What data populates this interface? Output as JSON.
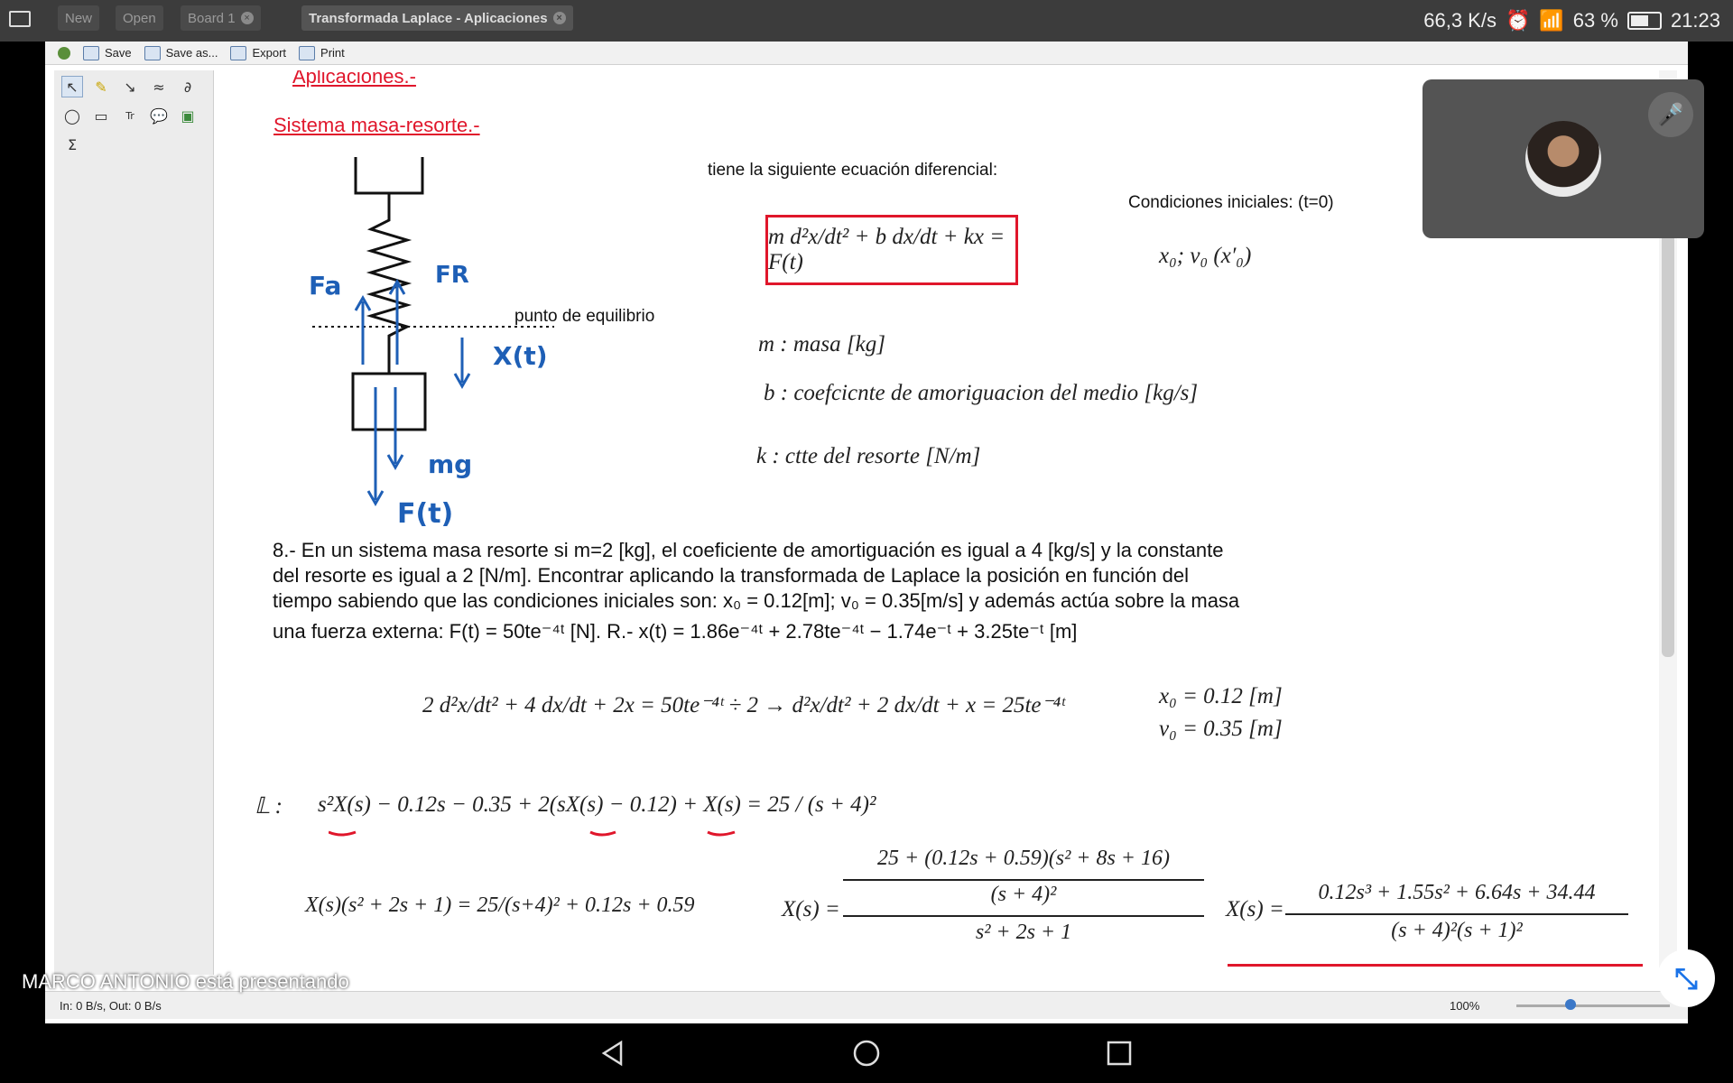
{
  "status": {
    "net_speed": "66,3 K/s",
    "battery": "63 %",
    "time": "21:23"
  },
  "tabs": [
    {
      "label": "New"
    },
    {
      "label": "Open"
    },
    {
      "label": "Board 1"
    },
    {
      "label": "Transformada Laplace - Aplicaciones"
    }
  ],
  "toolbar": {
    "save": "Save",
    "save_as": "Save as...",
    "export": "Export",
    "print": "Print"
  },
  "tools": {
    "sigma": "Σ",
    "text_tool": "Tr"
  },
  "doc": {
    "heading1": "Aplicaciones.-",
    "heading2": "Sistema masa-resorte.-",
    "diff_intro": "tiene la siguiente ecuación diferencial:",
    "init_cond": "Condiciones iniciales: (t=0)",
    "eq_main": "m d²x/dt² + b dx/dt + kx = F(t)",
    "init_vals": "x₀;  v₀ (x′₀)",
    "def_m": "m :  masa [kg]",
    "def_b": "b :  coefcicnte de amoriguacion del medio [kg/s]",
    "def_k": "k :  ctte del resorte [N/m]",
    "eq_label": "punto de equilibrio",
    "hand_fa": "Fa",
    "hand_fr": "FR",
    "hand_x": "X(t)",
    "hand_mg": "mg",
    "hand_f": "F(t)",
    "problem_l1": "8.- En un sistema masa resorte si m=2 [kg], el coeficiente de amortiguación es igual a 4 [kg/s] y la constante",
    "problem_l2": "del resorte es igual a 2 [N/m]. Encontrar aplicando la transformada de Laplace la posición en función del",
    "problem_l3": "tiempo sabiendo que las condiciones iniciales son:  x₀ = 0.12[m]; v₀ = 0.35[m/s]  y además actúa sobre la masa",
    "problem_l4": "una fuerza externa:  F(t) = 50te⁻⁴ᵗ [N]. R.-  x(t) = 1.86e⁻⁴ᵗ + 2.78te⁻⁴ᵗ − 1.74e⁻ᵗ + 3.25te⁻ᵗ [m]",
    "step1": "2 d²x/dt² + 4 dx/dt + 2x = 50te⁻⁴ᵗ    ÷ 2 →    d²x/dt² + 2 dx/dt + x = 25te⁻⁴ᵗ",
    "x0": "x₀ = 0.12 [m]",
    "v0": "v₀ = 0.35 [m]",
    "laplace_sym": "𝕃 :",
    "step2": "s²X(s) − 0.12s − 0.35 + 2(sX(s) − 0.12) + X(s) = 25 / (s + 4)²",
    "step3a": "X(s)(s² + 2s + 1) = 25/(s+4)² + 0.12s + 0.59",
    "step3b_num": "25 + (0.12s + 0.59)(s² + 8s + 16)",
    "step3b_mid": "(s + 4)²",
    "step3b_den": "s² + 2s + 1",
    "step3c_num": "0.12s³ + 1.55s² + 6.64s + 34.44",
    "step3c_den": "(s + 4)²(s + 1)²",
    "xs_label": "X(s) ="
  },
  "bottom": {
    "io": "In: 0 B/s, Out: 0 B/s",
    "zoom": "100%"
  },
  "presenter": "MARCO ANTONIO está presentando",
  "colors": {
    "red": "#e0162b",
    "hand_blue": "#1e5fb6",
    "tile": "#545454"
  }
}
